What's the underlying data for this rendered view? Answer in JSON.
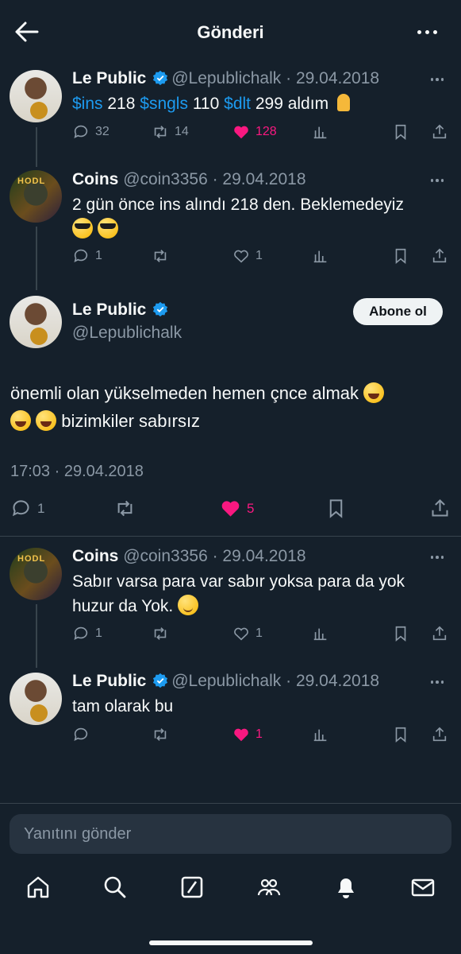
{
  "header": {
    "title": "Gönderi"
  },
  "thread": [
    {
      "name": "Le Public",
      "verified": true,
      "handle": "@Lepublichalk",
      "date": "29.04.2018",
      "text_parts": [
        "$ins",
        "218",
        "$sngls",
        "110",
        "$dlt",
        "299 aldım"
      ],
      "replies": "32",
      "retweets": "14",
      "likes": "128",
      "liked": true
    },
    {
      "name": "Coins",
      "verified": false,
      "handle": "@coin3356",
      "date": "29.04.2018",
      "text": "2 gün önce ins alındı 218 den. Beklemedeyiz",
      "replies": "1",
      "likes": "1"
    }
  ],
  "main_tweet": {
    "name": "Le Public",
    "handle": "@Lepublichalk",
    "follow_label": "Abone ol",
    "text_line1": "önemli olan yükselmeden hemen çnce almak",
    "text_line2": "bizimkiler sabırsız",
    "timestamp": "17:03 · 29.04.2018",
    "replies": "1",
    "likes": "5"
  },
  "replies": [
    {
      "name": "Coins",
      "handle": "@coin3356",
      "date": "29.04.2018",
      "text_line1": "Sabır varsa para var sabır yoksa para da yok",
      "text_line2": "huzur da Yok.",
      "replies": "1",
      "likes": "1"
    },
    {
      "name": "Le Public",
      "verified": true,
      "handle": "@Lepublichalk",
      "date": "29.04.2018",
      "text": "tam olarak bu",
      "likes": "1",
      "liked": true
    }
  ],
  "reply_bar": {
    "placeholder": "Yanıtını gönder"
  },
  "colors": {
    "background": "#15202b",
    "accent": "#1d9bf0",
    "like": "#f91880",
    "muted": "#8b98a5"
  },
  "tabs": [
    "home-icon",
    "search-icon",
    "grok-icon",
    "communities-icon",
    "notifications-icon",
    "messages-icon"
  ]
}
